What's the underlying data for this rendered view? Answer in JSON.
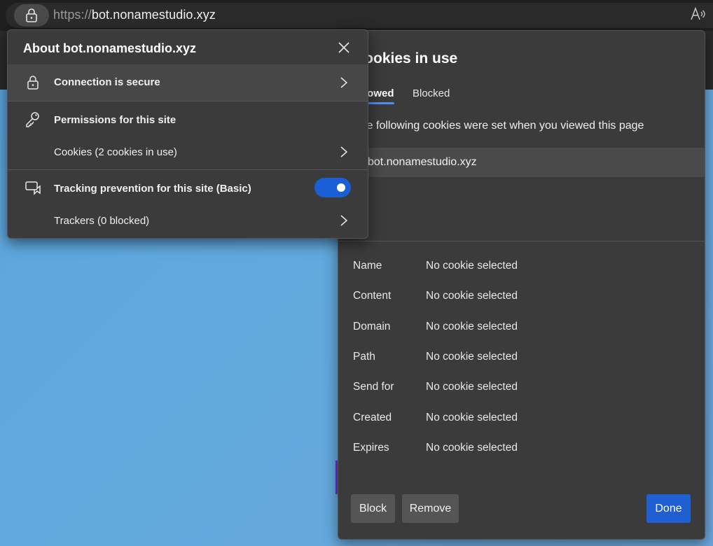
{
  "address_bar": {
    "scheme": "https://",
    "host": "bot.nonamestudio.xyz",
    "read_aloud_label": "A̅"
  },
  "site_info": {
    "title": "About bot.nonamestudio.xyz",
    "connection": "Connection is secure",
    "permissions": "Permissions for this site",
    "cookies": "Cookies (2 cookies in use)",
    "tracking": "Tracking prevention for this site (Basic)",
    "tracking_enabled": true,
    "trackers": "Trackers (0 blocked)"
  },
  "cookies_panel": {
    "title": "Cookies in use",
    "tabs": [
      "Allowed",
      "Blocked"
    ],
    "active_tab": "Allowed",
    "description": "The following cookies were set when you viewed this page",
    "site": "bot.nonamestudio.xyz",
    "details": [
      {
        "label": "Name",
        "value": "No cookie selected"
      },
      {
        "label": "Content",
        "value": "No cookie selected"
      },
      {
        "label": "Domain",
        "value": "No cookie selected"
      },
      {
        "label": "Path",
        "value": "No cookie selected"
      },
      {
        "label": "Send for",
        "value": "No cookie selected"
      },
      {
        "label": "Created",
        "value": "No cookie selected"
      },
      {
        "label": "Expires",
        "value": "No cookie selected"
      }
    ],
    "buttons": {
      "block": "Block",
      "remove": "Remove",
      "done": "Done"
    }
  },
  "colors": {
    "accent": "#1f5fd1",
    "panel_bg": "#3b3b3b",
    "toggle_on": "#1a5fd6"
  }
}
